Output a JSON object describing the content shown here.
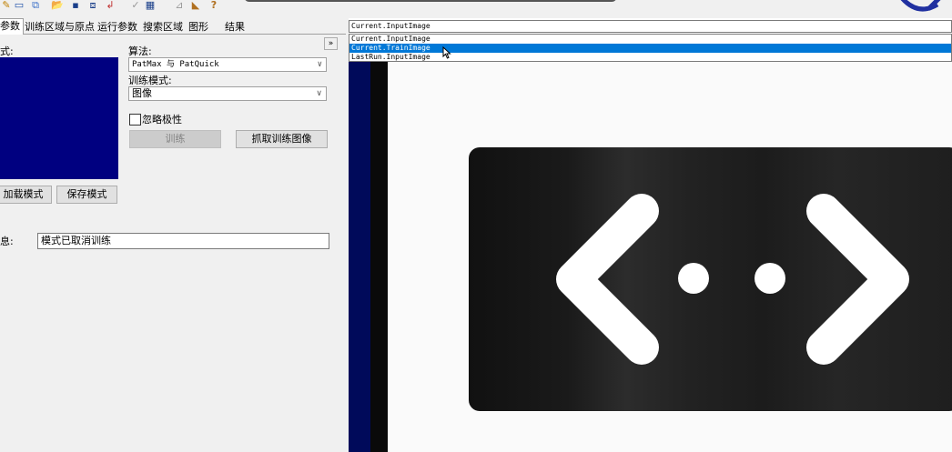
{
  "tabs": [
    {
      "label": "参数",
      "active": true
    },
    {
      "label": "训练区域与原点"
    },
    {
      "label": "运行参数"
    },
    {
      "label": "搜索区域"
    },
    {
      "label": "图形"
    },
    {
      "label": "结果"
    }
  ],
  "toolbar": {
    "icons": [
      "edit-icon",
      "image-icon",
      "copy-icon",
      "open-folder-icon",
      "save-icon",
      "grab-image-icon",
      "import-icon",
      "checkmark-icon",
      "readout-icon",
      "graphics-icon",
      "chart-icon",
      "help-icon"
    ]
  },
  "left": {
    "mode_label": "式:",
    "algorithm_label": "算法:",
    "algorithm_value": "PatMax 与 PatQuick",
    "train_mode_label": "训练模式:",
    "train_mode_value": "图像",
    "ignore_polarity_label": "忽略极性",
    "train_button": "训练",
    "grab_train_image_button": "抓取训练图像",
    "load_pattern_button": "加载模式",
    "save_pattern_button": "保存模式",
    "message_label": "息:",
    "message_value": "模式已取消训练"
  },
  "image_source": {
    "current": "Current.InputImage",
    "options": [
      "Current.InputImage",
      "Current.TrainImage",
      "LastRun.InputImage"
    ],
    "highlighted_index": 1
  },
  "colors": {
    "preview_bg": "#000080",
    "selection": "#0078d7"
  }
}
